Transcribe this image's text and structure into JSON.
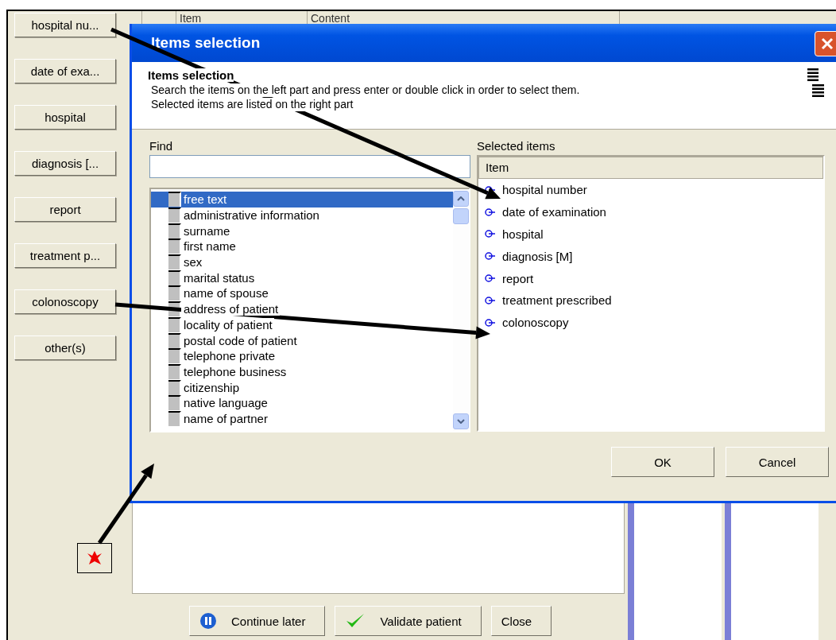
{
  "background": {
    "side_buttons": [
      "hospital nu...",
      "date of exa...",
      "hospital",
      "diagnosis [...",
      "report",
      "treatment p...",
      "colonoscopy",
      "other(s)"
    ],
    "columns": [
      "Item",
      "Content"
    ],
    "footer_buttons": [
      {
        "label": "Continue later",
        "kind": "pause"
      },
      {
        "label": "Validate patient",
        "kind": "check"
      },
      {
        "label": "Close",
        "kind": "plain"
      }
    ]
  },
  "dialog": {
    "title": "Items selection",
    "heading": "Items selection",
    "description": [
      "Search the items on the left part and press enter or double click in order to select them.",
      "Selected items are listed on the right part"
    ],
    "find_label": "Find",
    "available_items": [
      {
        "label": "free text",
        "selected": true
      },
      {
        "label": "administrative information",
        "selected": false
      },
      {
        "label": "surname",
        "selected": false
      },
      {
        "label": "first name",
        "selected": false
      },
      {
        "label": "sex",
        "selected": false
      },
      {
        "label": "marital status",
        "selected": false
      },
      {
        "label": "name of spouse",
        "selected": false
      },
      {
        "label": "address of patient",
        "selected": false
      },
      {
        "label": "locality of patient",
        "selected": false
      },
      {
        "label": "postal code of patient",
        "selected": false
      },
      {
        "label": "telephone private",
        "selected": false
      },
      {
        "label": "telephone business",
        "selected": false
      },
      {
        "label": "citizenship",
        "selected": false
      },
      {
        "label": "native language",
        "selected": false
      },
      {
        "label": "name of partner",
        "selected": false
      }
    ],
    "selected_label": "Selected items",
    "selected_column": "Item",
    "selected_items": [
      "hospital number",
      "date of examination",
      "hospital",
      "diagnosis [M]",
      "report",
      "treatment prescribed",
      "colonoscopy"
    ],
    "buttons": [
      "OK",
      "Cancel"
    ]
  }
}
